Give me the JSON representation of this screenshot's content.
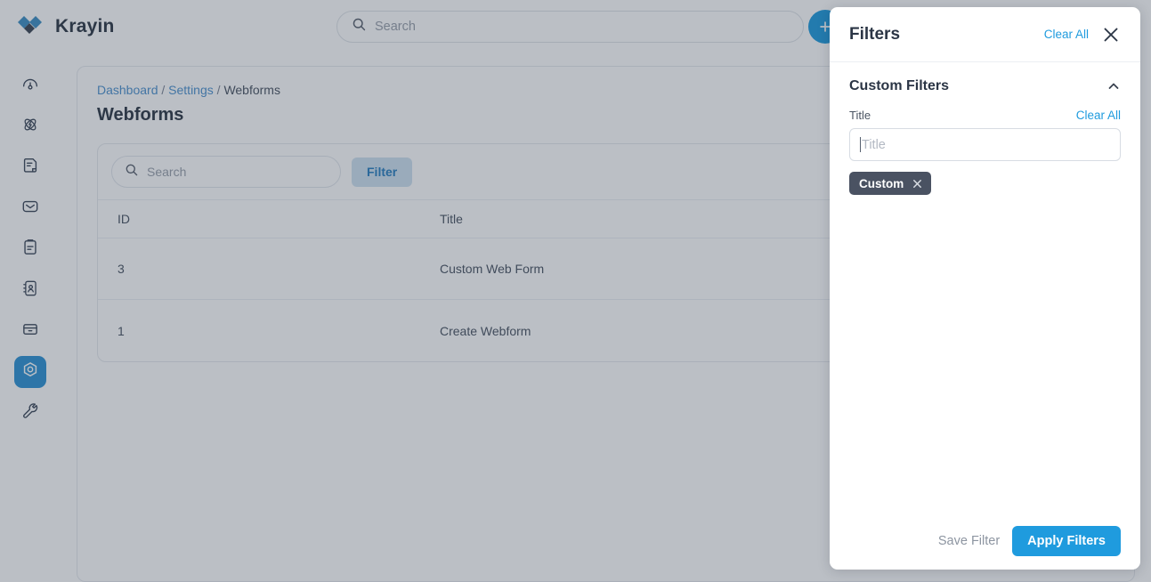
{
  "app": {
    "brand_name": "Krayin",
    "logo_colors": {
      "primary": "#3e8fc4",
      "secondary": "#3c4655"
    }
  },
  "topbar": {
    "search_placeholder": "Search",
    "search_value": "",
    "add_button_label": "+"
  },
  "sidebar": {
    "items": [
      {
        "name": "dashboard",
        "icon": "gauge-icon",
        "active": false
      },
      {
        "name": "leads",
        "icon": "atom-icon",
        "active": false
      },
      {
        "name": "quotes",
        "icon": "document-icon",
        "active": false
      },
      {
        "name": "mail",
        "icon": "envelope-icon",
        "active": false
      },
      {
        "name": "activities",
        "icon": "clipboard-icon",
        "active": false
      },
      {
        "name": "contacts",
        "icon": "address-book-icon",
        "active": false
      },
      {
        "name": "products",
        "icon": "box-icon",
        "active": false
      },
      {
        "name": "settings",
        "icon": "hexagon-gear-icon",
        "active": true
      },
      {
        "name": "configuration",
        "icon": "wrench-icon",
        "active": false
      }
    ]
  },
  "breadcrumb": {
    "items": [
      {
        "label": "Dashboard",
        "link": true
      },
      {
        "label": "Settings",
        "link": true
      },
      {
        "label": "Webforms",
        "link": false
      }
    ],
    "separator": "/"
  },
  "page": {
    "title": "Webforms"
  },
  "table_toolbar": {
    "search_placeholder": "Search",
    "search_value": "",
    "filter_label": "Filter"
  },
  "table": {
    "columns": [
      "ID",
      "Title"
    ],
    "rows": [
      {
        "id": "3",
        "title": "Custom Web Form"
      },
      {
        "id": "1",
        "title": "Create Webform"
      }
    ]
  },
  "filter_drawer": {
    "title": "Filters",
    "clear_all_label": "Clear All",
    "close_icon": "close-icon",
    "section": {
      "title": "Custom Filters",
      "collapse_icon": "chevron-up-icon",
      "field_label": "Title",
      "field_clear_all_label": "Clear All",
      "input_placeholder": "Title",
      "input_value": "",
      "chips": [
        {
          "label": "Custom",
          "remove_icon": "close-icon"
        }
      ]
    },
    "footer": {
      "save_label": "Save Filter",
      "apply_label": "Apply Filters"
    },
    "accent_color": "#1f9bde",
    "chip_color": "#4a5262"
  }
}
